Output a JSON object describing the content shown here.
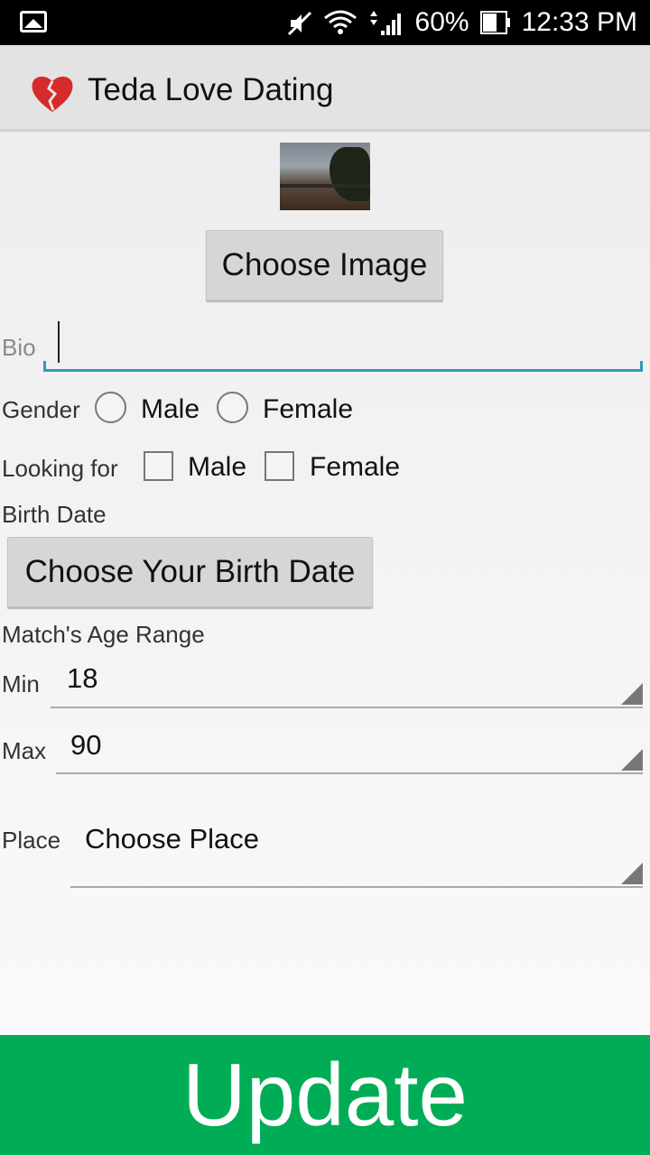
{
  "status_bar": {
    "battery": "60%",
    "time": "12:33 PM"
  },
  "app_bar": {
    "logo_text": "Teda Love Dating",
    "title": "Teda Love Dating"
  },
  "form": {
    "choose_image_label": "Choose Image",
    "bio_label": "Bio",
    "bio_value": "",
    "gender_label": "Gender",
    "gender_options": [
      "Male",
      "Female"
    ],
    "looking_for_label": "Looking for",
    "looking_for_options": [
      "Male",
      "Female"
    ],
    "birth_date_label": "Birth Date",
    "birth_date_button": "Choose Your Birth Date",
    "age_range_label": "Match's Age Range",
    "min_label": "Min",
    "min_value": "18",
    "max_label": "Max",
    "max_value": "90",
    "place_label": "Place",
    "place_value": "Choose Place",
    "update_button": "Update"
  },
  "colors": {
    "accent": "#2a9bbd",
    "update_button": "#00ad56",
    "status_bar": "#000000",
    "action_bar": "#e3e3e3"
  }
}
